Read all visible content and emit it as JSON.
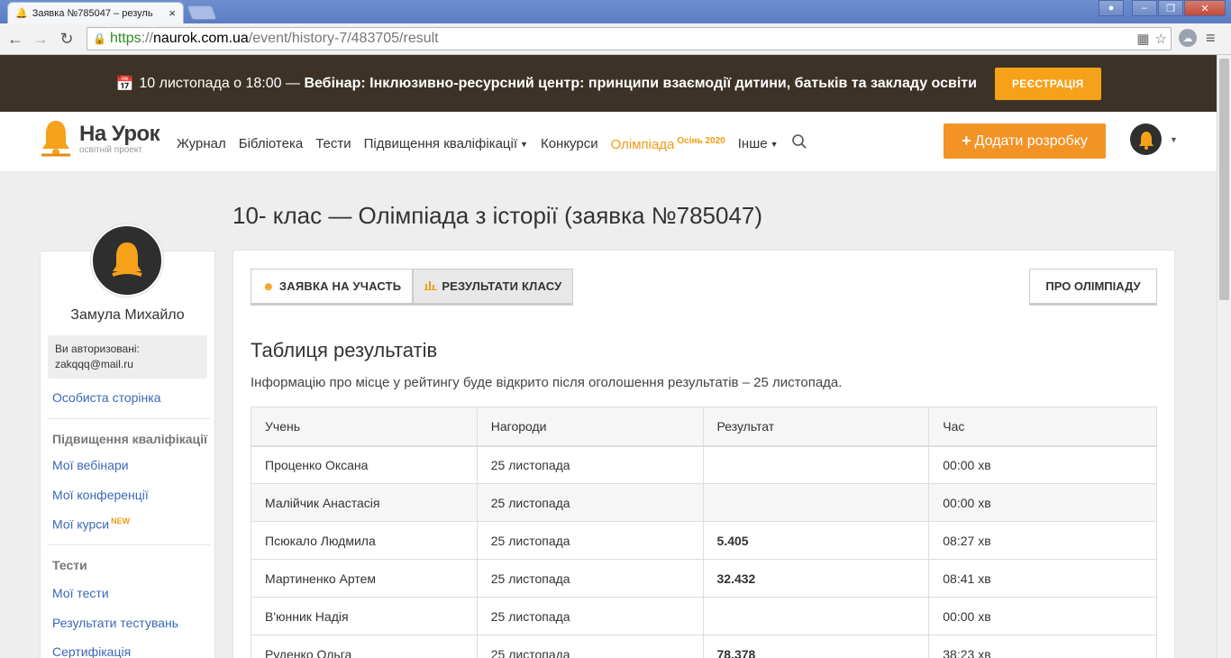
{
  "browser": {
    "tab_title": "Заявка №785047 – резуль",
    "tab_close": "×",
    "url_https": "https",
    "url_sep": "://",
    "url_host": "naurok.com.ua",
    "url_path": "/event/history-7/483705/result"
  },
  "banner": {
    "date_text": "10 листопада о 18:00 — ",
    "webinar_text": "Вебінар: Інклюзивно-ресурсний центр: принципи взаємодії дитини, батьків та закладу освіти",
    "register_label": "РЕЄСТРАЦІЯ"
  },
  "header": {
    "logo_name": "На Урок",
    "logo_sub": "освітній проект",
    "nav": {
      "journal": "Журнал",
      "library": "Бібліотека",
      "tests": "Тести",
      "qualification": "Підвищення кваліфікації",
      "contests": "Конкурси",
      "olympiad": "Олімпіада",
      "olympiad_badge": "Осінь 2020",
      "other": "Інше"
    },
    "add_button": "Додати розробку"
  },
  "sidebar": {
    "user_name": "Замула Михайло",
    "auth_label": "Ви авторизовані:",
    "auth_email": "zakqqq@mail.ru",
    "personal_page": "Особиста сторінка",
    "qualification_heading": "Підвищення кваліфікації",
    "my_webinars": "Мої вебінари",
    "my_conferences": "Мої конференції",
    "my_courses": "Мої курси",
    "new_badge": "NEW",
    "tests_heading": "Тести",
    "my_tests": "Мої тести",
    "test_results": "Результати тестувань",
    "certification": "Сертифікація"
  },
  "main": {
    "page_title": "10- клас — Олімпіада з історії (заявка №785047)",
    "tab_application": "ЗАЯВКА НА УЧАСТЬ",
    "tab_results": "РЕЗУЛЬТАТИ КЛАСУ",
    "about_button": "ПРО ОЛІМПІАДУ",
    "section_title": "Таблиця результатів",
    "info_text": "Інформацію про місце у рейтингу буде відкрито після оголошення результатів – 25 листопада.",
    "table": {
      "headers": [
        "Учень",
        "Нагороди",
        "Результат",
        "Час"
      ],
      "rows": [
        {
          "student": "Проценко Оксана",
          "awards": "25 листопада",
          "result": "",
          "time": "00:00 хв"
        },
        {
          "student": "Малійчик Анастасія",
          "awards": "25 листопада",
          "result": "",
          "time": "00:00 хв"
        },
        {
          "student": "Псюкало Людмила",
          "awards": "25 листопада",
          "result": "5.405",
          "time": "08:27 хв"
        },
        {
          "student": "Мартиненко Артем",
          "awards": "25 листопада",
          "result": "32.432",
          "time": "08:41 хв"
        },
        {
          "student": "В'юнник Надія",
          "awards": "25 листопада",
          "result": "",
          "time": "00:00 хв"
        },
        {
          "student": "Руденко Ольга",
          "awards": "25 листопада",
          "result": "78.378",
          "time": "38:23 хв"
        }
      ]
    }
  },
  "colors": {
    "accent_orange": "#f39325",
    "banner_bg": "#3c3326",
    "link_blue": "#3a68b7"
  }
}
